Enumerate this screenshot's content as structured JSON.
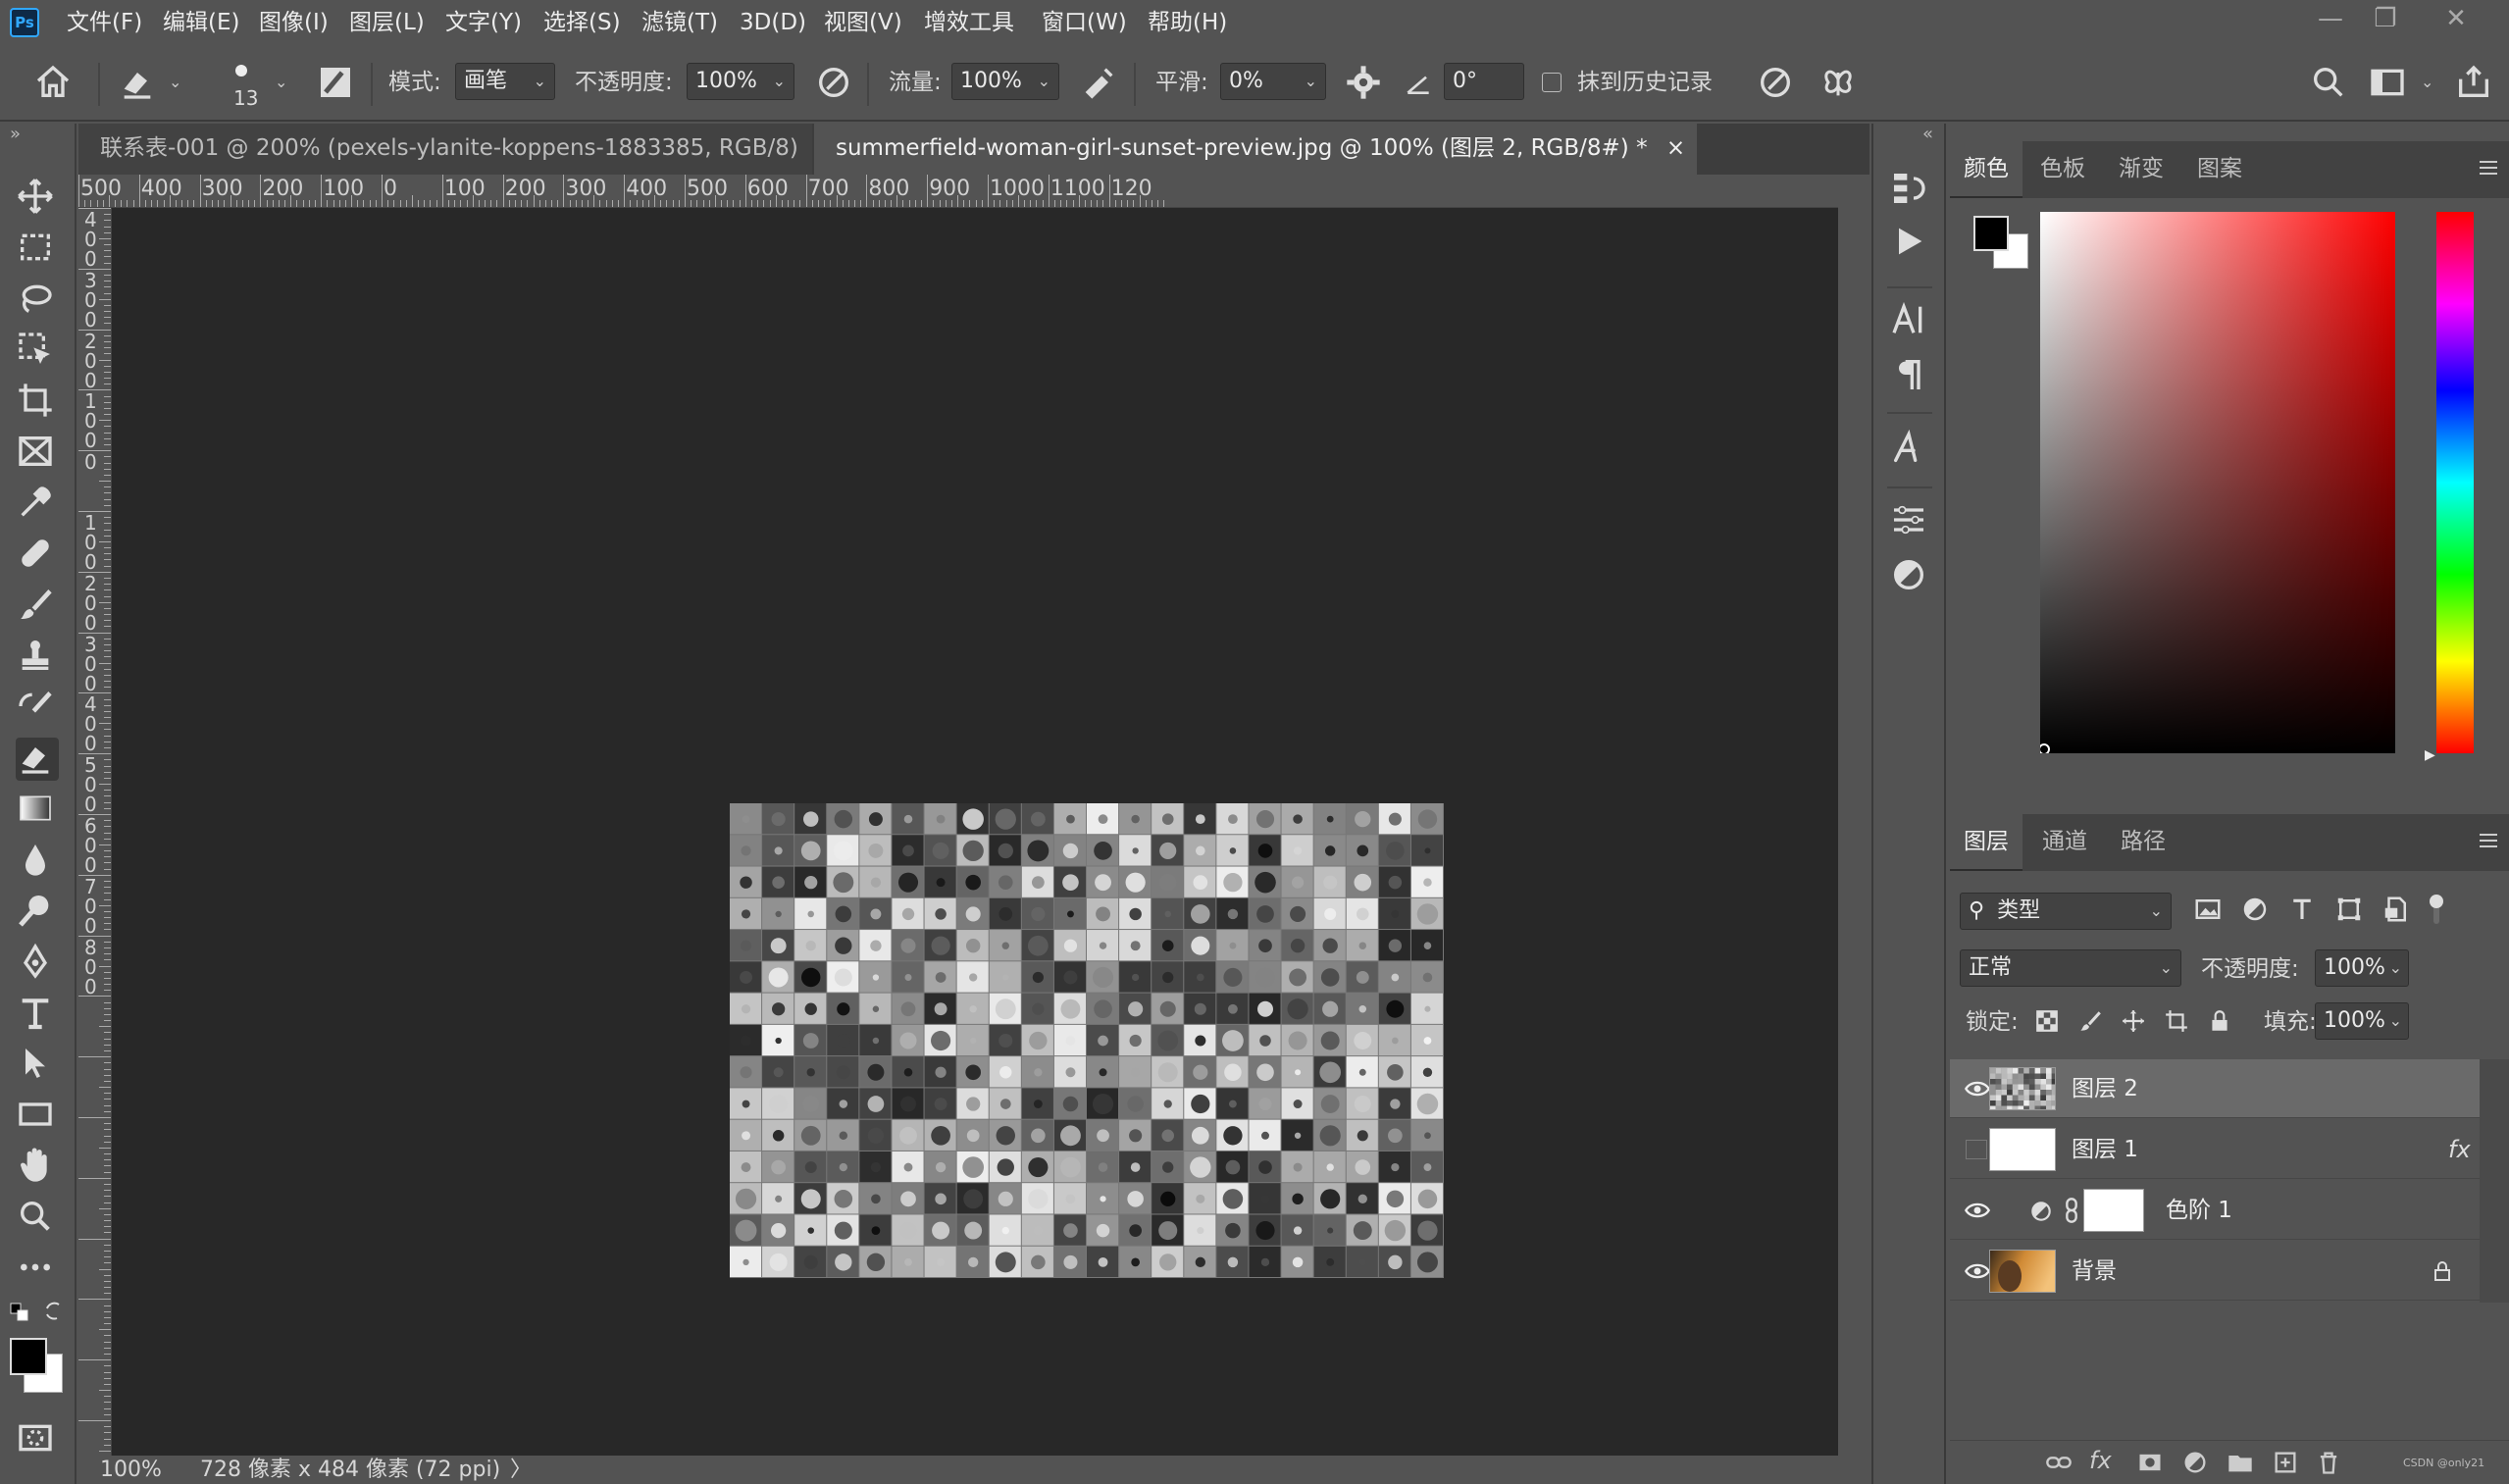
{
  "app": {
    "logo": "Ps",
    "menu": [
      "文件(F)",
      "编辑(E)",
      "图像(I)",
      "图层(L)",
      "文字(Y)",
      "选择(S)",
      "滤镜(T)",
      "3D(D)",
      "视图(V)",
      "增效工具",
      "窗口(W)",
      "帮助(H)"
    ]
  },
  "options": {
    "brush_size": "13",
    "mode_label": "模式:",
    "mode_value": "画笔",
    "opacity_label": "不透明度:",
    "opacity_value": "100%",
    "flow_label": "流量:",
    "flow_value": "100%",
    "smooth_label": "平滑:",
    "smooth_value": "0%",
    "angle_value": "0°",
    "history_label": "抹到历史记录"
  },
  "tabs": [
    {
      "label": "联系表-001 @ 200% (pexels-ylanite-koppens-1883385, RGB/8) *",
      "close": "×"
    },
    {
      "label": "summerfield-woman-girl-sunset-preview.jpg @ 100% (图层 2, RGB/8#) *",
      "close": "×"
    }
  ],
  "ruler_top": [
    "500",
    "400",
    "300",
    "200",
    "100",
    "0",
    "100",
    "200",
    "300",
    "400",
    "500",
    "600",
    "700",
    "800",
    "900",
    "1000",
    "1100",
    "120"
  ],
  "ruler_left": [
    "4\n0\n0",
    "3\n0\n0",
    "2\n0\n0",
    "1\n0\n0",
    "0",
    "1\n0\n0",
    "2\n0\n0",
    "3\n0\n0",
    "4\n0\n0",
    "5\n0\n0",
    "6\n0\n0",
    "7\n0\n0",
    "8\n0\n0"
  ],
  "status": {
    "zoom": "100%",
    "info": "728 像素 x 484 像素 (72 ppi)",
    "arrow": "〉"
  },
  "color_panel": {
    "tabs": [
      "颜色",
      "色板",
      "渐变",
      "图案"
    ],
    "foreground": "#000000",
    "background": "#ffffff",
    "hue": "#ff0000"
  },
  "layers_panel": {
    "tabs": [
      "图层",
      "通道",
      "路径"
    ],
    "filter_label": "类型",
    "blend_mode": "正常",
    "opacity_label": "不透明度:",
    "opacity_value": "100%",
    "lock_label": "锁定:",
    "fill_label": "填充:",
    "fill_value": "100%",
    "layers": [
      {
        "name": "图层 2",
        "visible": true,
        "selected": true
      },
      {
        "name": "图层 1",
        "visible": false,
        "selected": false,
        "fx": "fx"
      },
      {
        "name": "色阶 1",
        "visible": true,
        "selected": false
      },
      {
        "name": "背景",
        "visible": true,
        "selected": false,
        "locked": true
      }
    ],
    "watermark": "CSDN @only21"
  }
}
